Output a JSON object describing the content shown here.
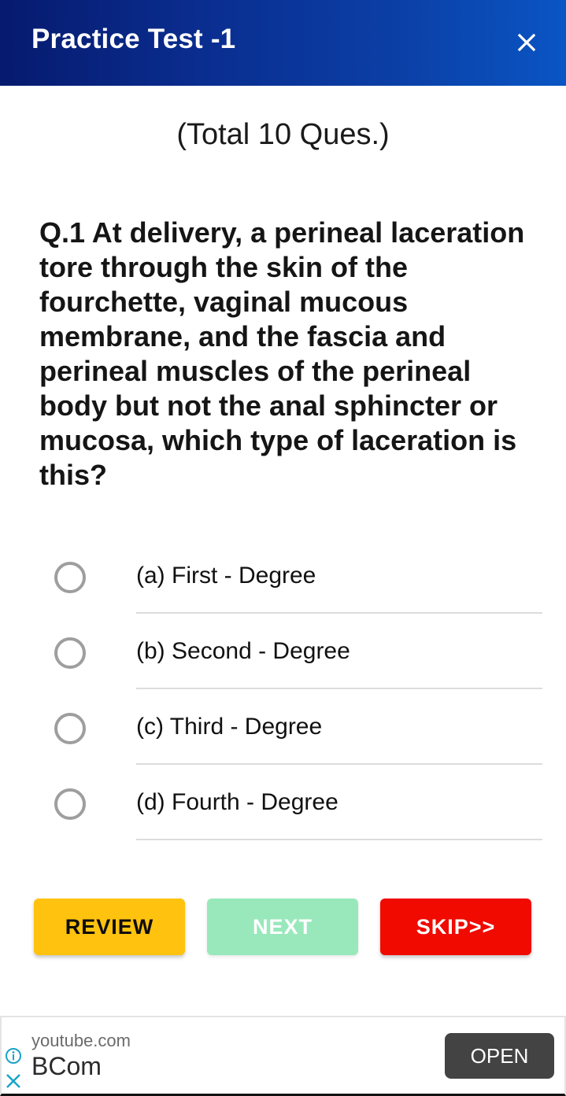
{
  "header": {
    "title": "Practice Test -1",
    "close_icon": "close-icon"
  },
  "quiz": {
    "total_label": "(Total 10 Ques.)",
    "question": "Q.1 At delivery, a perineal laceration tore through the skin of the fourchette, vaginal mucous membrane, and the fascia and perineal muscles of the perineal body but not the anal sphincter or mucosa, which type of laceration is this?",
    "options": [
      {
        "label": "(a) First - Degree",
        "selected": false
      },
      {
        "label": "(b) Second - Degree",
        "selected": false
      },
      {
        "label": "(c) Third - Degree",
        "selected": false
      },
      {
        "label": "(d) Fourth - Degree",
        "selected": false
      }
    ]
  },
  "actions": {
    "review_label": "REVIEW",
    "next_label": "NEXT",
    "skip_label": "SKIP>>",
    "colors": {
      "review": "#ffc20e",
      "next": "#98e8bb",
      "skip": "#f00a00"
    }
  },
  "ad": {
    "domain": "youtube.com",
    "title": "BCom",
    "open_label": "OPEN",
    "info_icon": "info-icon",
    "close_icon": "close-icon",
    "accent_color": "#1aa3c8"
  }
}
